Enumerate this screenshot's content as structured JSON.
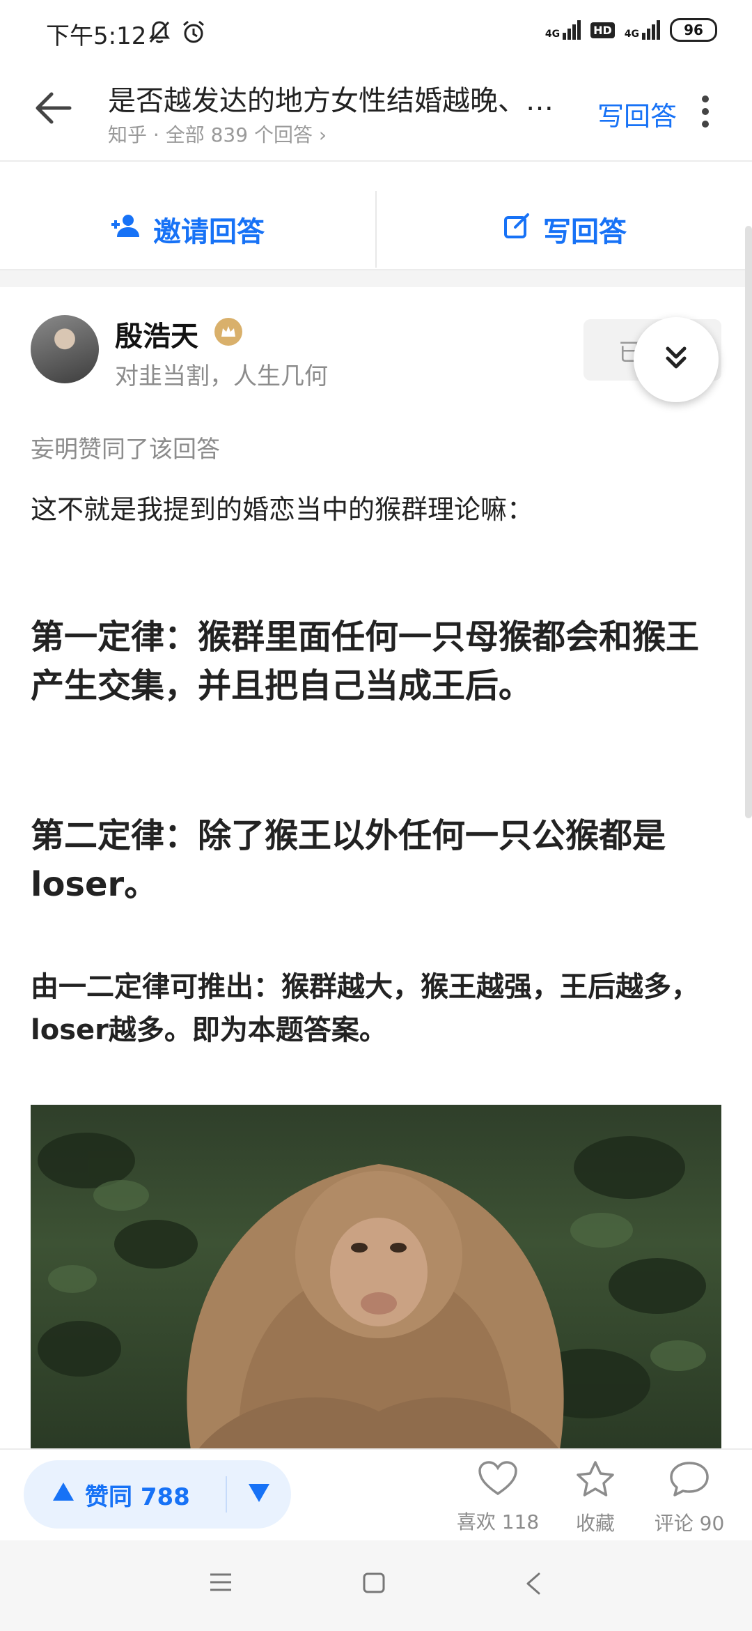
{
  "status_bar": {
    "time": "下午5:12",
    "signal1_label": "4G",
    "hd_label": "HD",
    "signal2_label": "4G",
    "battery": "96"
  },
  "header": {
    "title": "是否越发达的地方女性结婚越晚、…",
    "subtitle": "知乎 · 全部 839 个回答 ›",
    "write_answer": "写回答"
  },
  "action_bar": {
    "invite_label": "邀请回答",
    "write_label": "写回答"
  },
  "author": {
    "name": "殷浩天",
    "bio": "对韭当割，人生几何",
    "follow_label": "已"
  },
  "answer": {
    "liked_by": "妄明赞同了该回答",
    "intro": "这不就是我提到的婚恋当中的猴群理论嘛：",
    "law1": "第一定律：猴群里面任何一只母猴都会和猴王产生交集，并且把自己当成王后。",
    "law2": "第二定律：除了猴王以外任何一只公猴都是loser。",
    "inference": "由一二定律可推出：猴群越大，猴王越强，王后越多，loser越多。即为本题答案。"
  },
  "bottom_bar": {
    "upvote_label": "赞同 788",
    "like_label": "喜欢 118",
    "favorite_label": "收藏",
    "comment_label": "评论 90"
  },
  "colors": {
    "accent": "#1772f6",
    "muted": "#8c8c8c",
    "vote_bg": "#e9f2fe"
  }
}
